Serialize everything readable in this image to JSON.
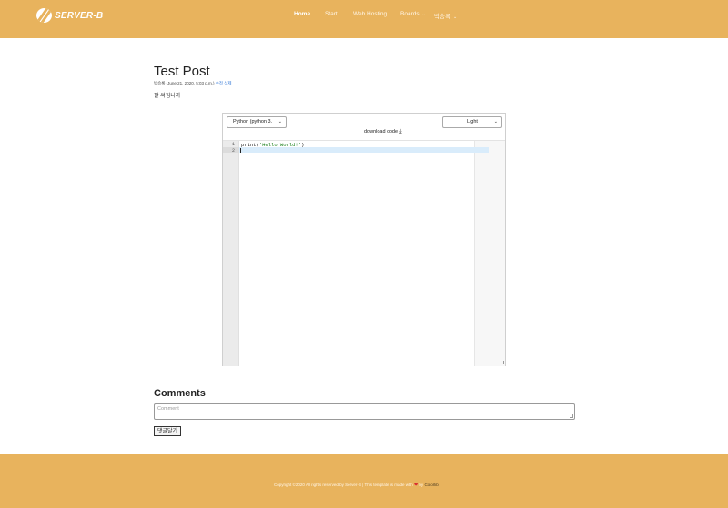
{
  "header": {
    "logo_text": "SERVER-B",
    "nav": [
      {
        "label": "Home"
      },
      {
        "label": "Start"
      },
      {
        "label": "Web Hosting"
      },
      {
        "label": "Boards"
      },
      {
        "label": "박승록"
      }
    ]
  },
  "post": {
    "title": "Test Post",
    "author": "박승록",
    "date": " (June 21, 2020, 5:03 p.m.) ",
    "edit": "수정",
    "delete": "삭제",
    "body": "잘 써집니까"
  },
  "editor": {
    "language": "Python (python 3.",
    "theme": "Light",
    "download_label": "download code",
    "line_numbers": [
      "1",
      "2"
    ],
    "code_prefix": "print(",
    "code_string": "'Hello World!'",
    "code_suffix": ")"
  },
  "comments": {
    "title": "Comments",
    "placeholder": "Comment",
    "submit_label": "댓글달기"
  },
  "footer": {
    "text": "Copyright ©2020 All rights reserved by Server-B | This template is made with ",
    "by": " by ",
    "link": "Colorlib"
  },
  "colors": {
    "brand": "#e8b35d",
    "active_line": "#d9ecfb",
    "heart": "#d8282f"
  }
}
